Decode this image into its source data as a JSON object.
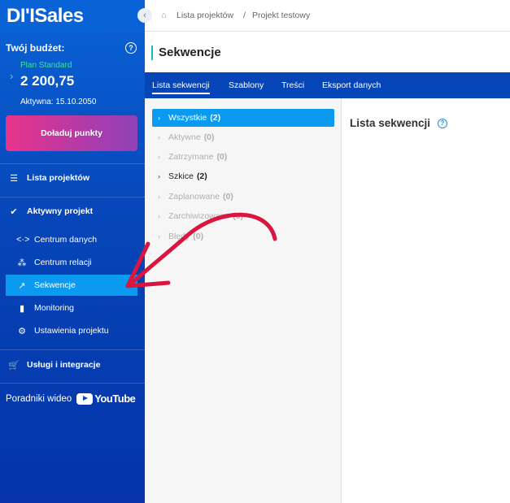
{
  "app": {
    "logo": "DI'ISales"
  },
  "budget": {
    "title": "Twój budżet:",
    "plan": "Plan Standard",
    "value": "2 200,75",
    "active_until": "Aktywna: 15.10.2050",
    "topup_label": "Doładuj punkty"
  },
  "sidebar": {
    "projects_label": "Lista projektów",
    "active_project_label": "Aktywny projekt",
    "sub_items": [
      {
        "label": "Centrum danych"
      },
      {
        "label": "Centrum relacji"
      },
      {
        "label": "Sekwencje"
      },
      {
        "label": "Monitoring"
      },
      {
        "label": "Ustawienia projektu"
      }
    ],
    "services_label": "Usługi i integracje",
    "guides_label": "Poradniki wideo",
    "youtube_label": "YouTube"
  },
  "breadcrumb": [
    "Lista projektów",
    "/",
    "Projekt testowy"
  ],
  "page": {
    "title": "Sekwencje"
  },
  "tabs": [
    {
      "label": "Lista sekwencji"
    },
    {
      "label": "Szablony"
    },
    {
      "label": "Treści"
    },
    {
      "label": "Eksport danych"
    }
  ],
  "filters": [
    {
      "label": "Wszystkie",
      "count": "(2)"
    },
    {
      "label": "Aktywne",
      "count": "(0)"
    },
    {
      "label": "Zatrzymane",
      "count": "(0)"
    },
    {
      "label": "Szkice",
      "count": "(2)"
    },
    {
      "label": "Zaplanowane",
      "count": "(0)"
    },
    {
      "label": "Zarchiwizowane",
      "count": "(0)"
    },
    {
      "label": "Błędy",
      "count": "(0)"
    }
  ],
  "content": {
    "title": "Lista sekwencji"
  },
  "colors": {
    "accent": "#0a9af0",
    "nav": "#0645b8",
    "annotation": "#d8163f"
  }
}
